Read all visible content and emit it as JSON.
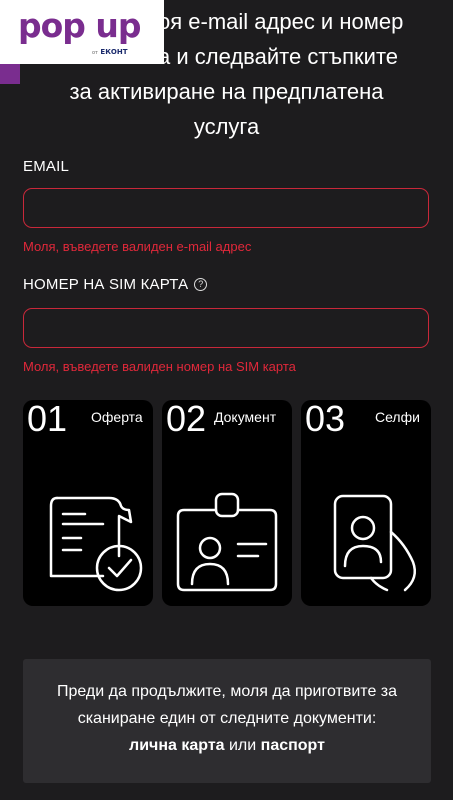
{
  "header": {
    "lines": [
      "оя e-mail адрес и номер",
      "а и следвайте стъпките",
      "за активиране на предплатена",
      "услуга"
    ]
  },
  "logo": {
    "text": "pop up",
    "by": "от",
    "brand": "ЕКОНТ"
  },
  "form": {
    "email_label": "EMAIL",
    "email_value": "",
    "email_error": "Моля, въведете валиден e-mail адрес",
    "sim_label": "НОМЕР НА SIM КАРТА",
    "sim_help": "?",
    "sim_value": "",
    "sim_error": "Моля, въведете валиден номер на SIM карта"
  },
  "steps": [
    {
      "num": "01",
      "title": "Оферта",
      "icon": "document-check-icon"
    },
    {
      "num": "02",
      "title": "Документ",
      "icon": "id-card-icon"
    },
    {
      "num": "03",
      "title": "Селфи",
      "icon": "phone-selfie-icon"
    }
  ],
  "note": {
    "line1": "Преди да продължите, моля да приготвите за",
    "line2": "сканиране един от следните документи:",
    "doc1": "лична карта",
    "connector": " или ",
    "doc2": "паспорт"
  },
  "colors": {
    "accent": "#7a2d8f",
    "error": "#e0283a",
    "background": "#1d1c1e"
  }
}
